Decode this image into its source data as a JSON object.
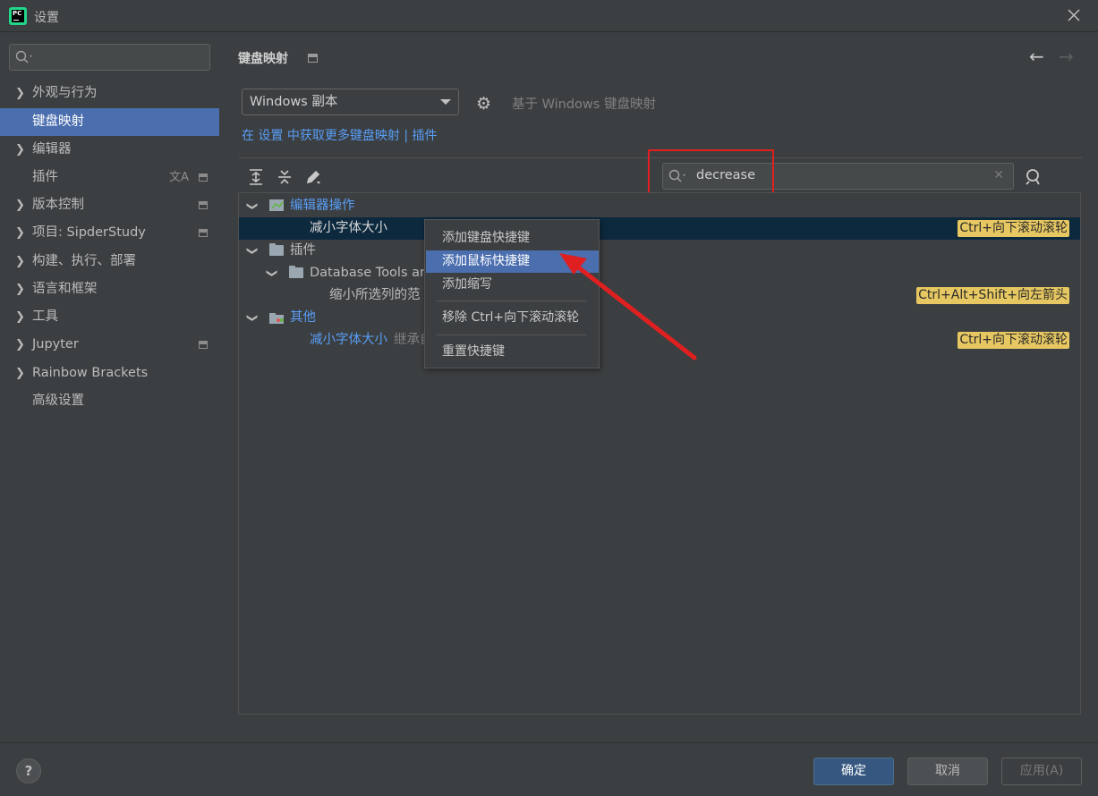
{
  "window": {
    "title": "设置"
  },
  "sidebar": {
    "search_placeholder": "",
    "items": [
      {
        "label": "外观与行为",
        "expandable": true
      },
      {
        "label": "键盘映射",
        "selected": true
      },
      {
        "label": "编辑器",
        "expandable": true
      },
      {
        "label": "插件"
      },
      {
        "label": "版本控制",
        "expandable": true
      },
      {
        "label": "项目: SipderStudy",
        "expandable": true
      },
      {
        "label": "构建、执行、部署",
        "expandable": true
      },
      {
        "label": "语言和框架",
        "expandable": true
      },
      {
        "label": "工具",
        "expandable": true
      },
      {
        "label": "Jupyter",
        "expandable": true
      },
      {
        "label": "Rainbow Brackets",
        "expandable": true
      },
      {
        "label": "高级设置"
      }
    ]
  },
  "main": {
    "breadcrumb": "键盘映射",
    "keymap_select": "Windows 副本",
    "based_on": "基于 Windows 键盘映射",
    "links": {
      "prefix": "在 ",
      "settings": "设置",
      "middle": " 中获取更多键盘映射 | ",
      "plugins": "插件"
    },
    "search": {
      "value": "decrease"
    }
  },
  "tree": {
    "rows": [
      {
        "label": "编辑器操作",
        "type": "group"
      },
      {
        "label": "减小字体大小",
        "shortcut": "Ctrl+向下滚动滚轮",
        "selected": true
      },
      {
        "label": "插件",
        "type": "group"
      },
      {
        "label": "Database Tools ar",
        "type": "group"
      },
      {
        "label": "缩小所选列的范",
        "shortcut": "Ctrl+Alt+Shift+向左箭头"
      },
      {
        "label": "其他",
        "type": "group"
      },
      {
        "label": "减小字体大小",
        "suffix": "继承自",
        "shortcut": "Ctrl+向下滚动滚轮"
      }
    ]
  },
  "context_menu": {
    "items": [
      {
        "label": "添加键盘快捷键"
      },
      {
        "label": "添加鼠标快捷键",
        "highlighted": true
      },
      {
        "label": "添加缩写"
      },
      {
        "label": "移除 Ctrl+向下滚动滚轮"
      },
      {
        "label": "重置快捷键"
      }
    ]
  },
  "footer": {
    "help": "?",
    "ok": "确定",
    "cancel": "取消",
    "apply": "应用(A)"
  },
  "colors": {
    "accent": "#4b6eaf",
    "link": "#589df6",
    "shortcut_bg": "#e6c761",
    "annotation": "#e02020"
  }
}
